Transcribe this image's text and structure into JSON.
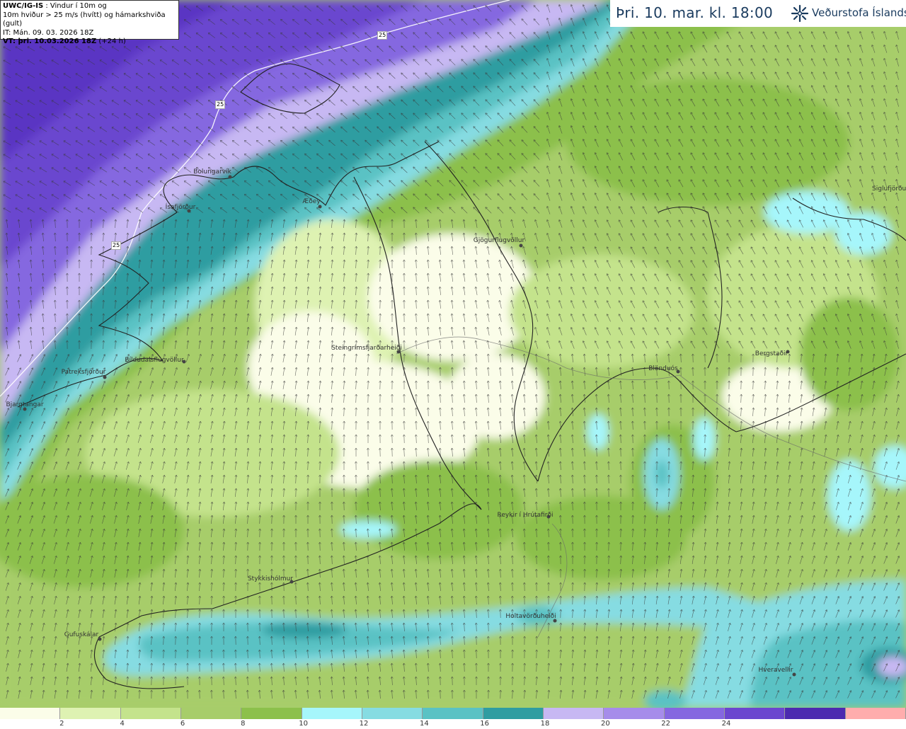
{
  "info": {
    "line1_bold": "UWC/IG-IS",
    "line1_rest": " : Vindur í 10m og",
    "line2": "10m hviður > 25 m/s (hvítt) og hámarkshviða (gult)",
    "line3": "IT: Mán. 09. 03. 2026 18Z",
    "line4_bold": "VT: þri. 10.03.2026 18Z",
    "line4_rest": " (+24 h)"
  },
  "header": {
    "valid_time": "Þri. 10. mar. kl. 18:00",
    "brand": "Veðurstofa Íslands"
  },
  "legend": {
    "ticks": [
      "2",
      "4",
      "6",
      "8",
      "10",
      "12",
      "14",
      "16",
      "18",
      "20",
      "22",
      "24"
    ],
    "colors": [
      "#fbfde9",
      "#def2b2",
      "#c4e38c",
      "#a7cd6a",
      "#8cc04b",
      "#a6f6fb",
      "#86dce2",
      "#5ac2c4",
      "#2f9da1",
      "#c7b8f3",
      "#a68cea",
      "#8567e0",
      "#6b46cf",
      "#4c2ab0",
      "#ffadad"
    ]
  },
  "contour_labels": [
    "25",
    "25",
    "25"
  ],
  "places": [
    {
      "name": "Bolungarvík"
    },
    {
      "name": "Ísafjörður"
    },
    {
      "name": "Æðey"
    },
    {
      "name": "Gjögurflugvöllur"
    },
    {
      "name": "Siglufjörður"
    },
    {
      "name": "Bíldudalsflugvöllur"
    },
    {
      "name": "Patreksfjörður"
    },
    {
      "name": "Bjargtangar"
    },
    {
      "name": "Steingrímsfjarðarheiði"
    },
    {
      "name": "Bergstaðir"
    },
    {
      "name": "Blönduós"
    },
    {
      "name": "Reykir í Hrútafirði"
    },
    {
      "name": "Stykkishólmur"
    },
    {
      "name": "Holtavörðuheiði"
    },
    {
      "name": "Gufuskálar"
    },
    {
      "name": "Hveravellir"
    }
  ],
  "colors": {
    "header_text": "#1a3b5e",
    "arrow": "#3a3a3a",
    "coast": "#222222"
  }
}
